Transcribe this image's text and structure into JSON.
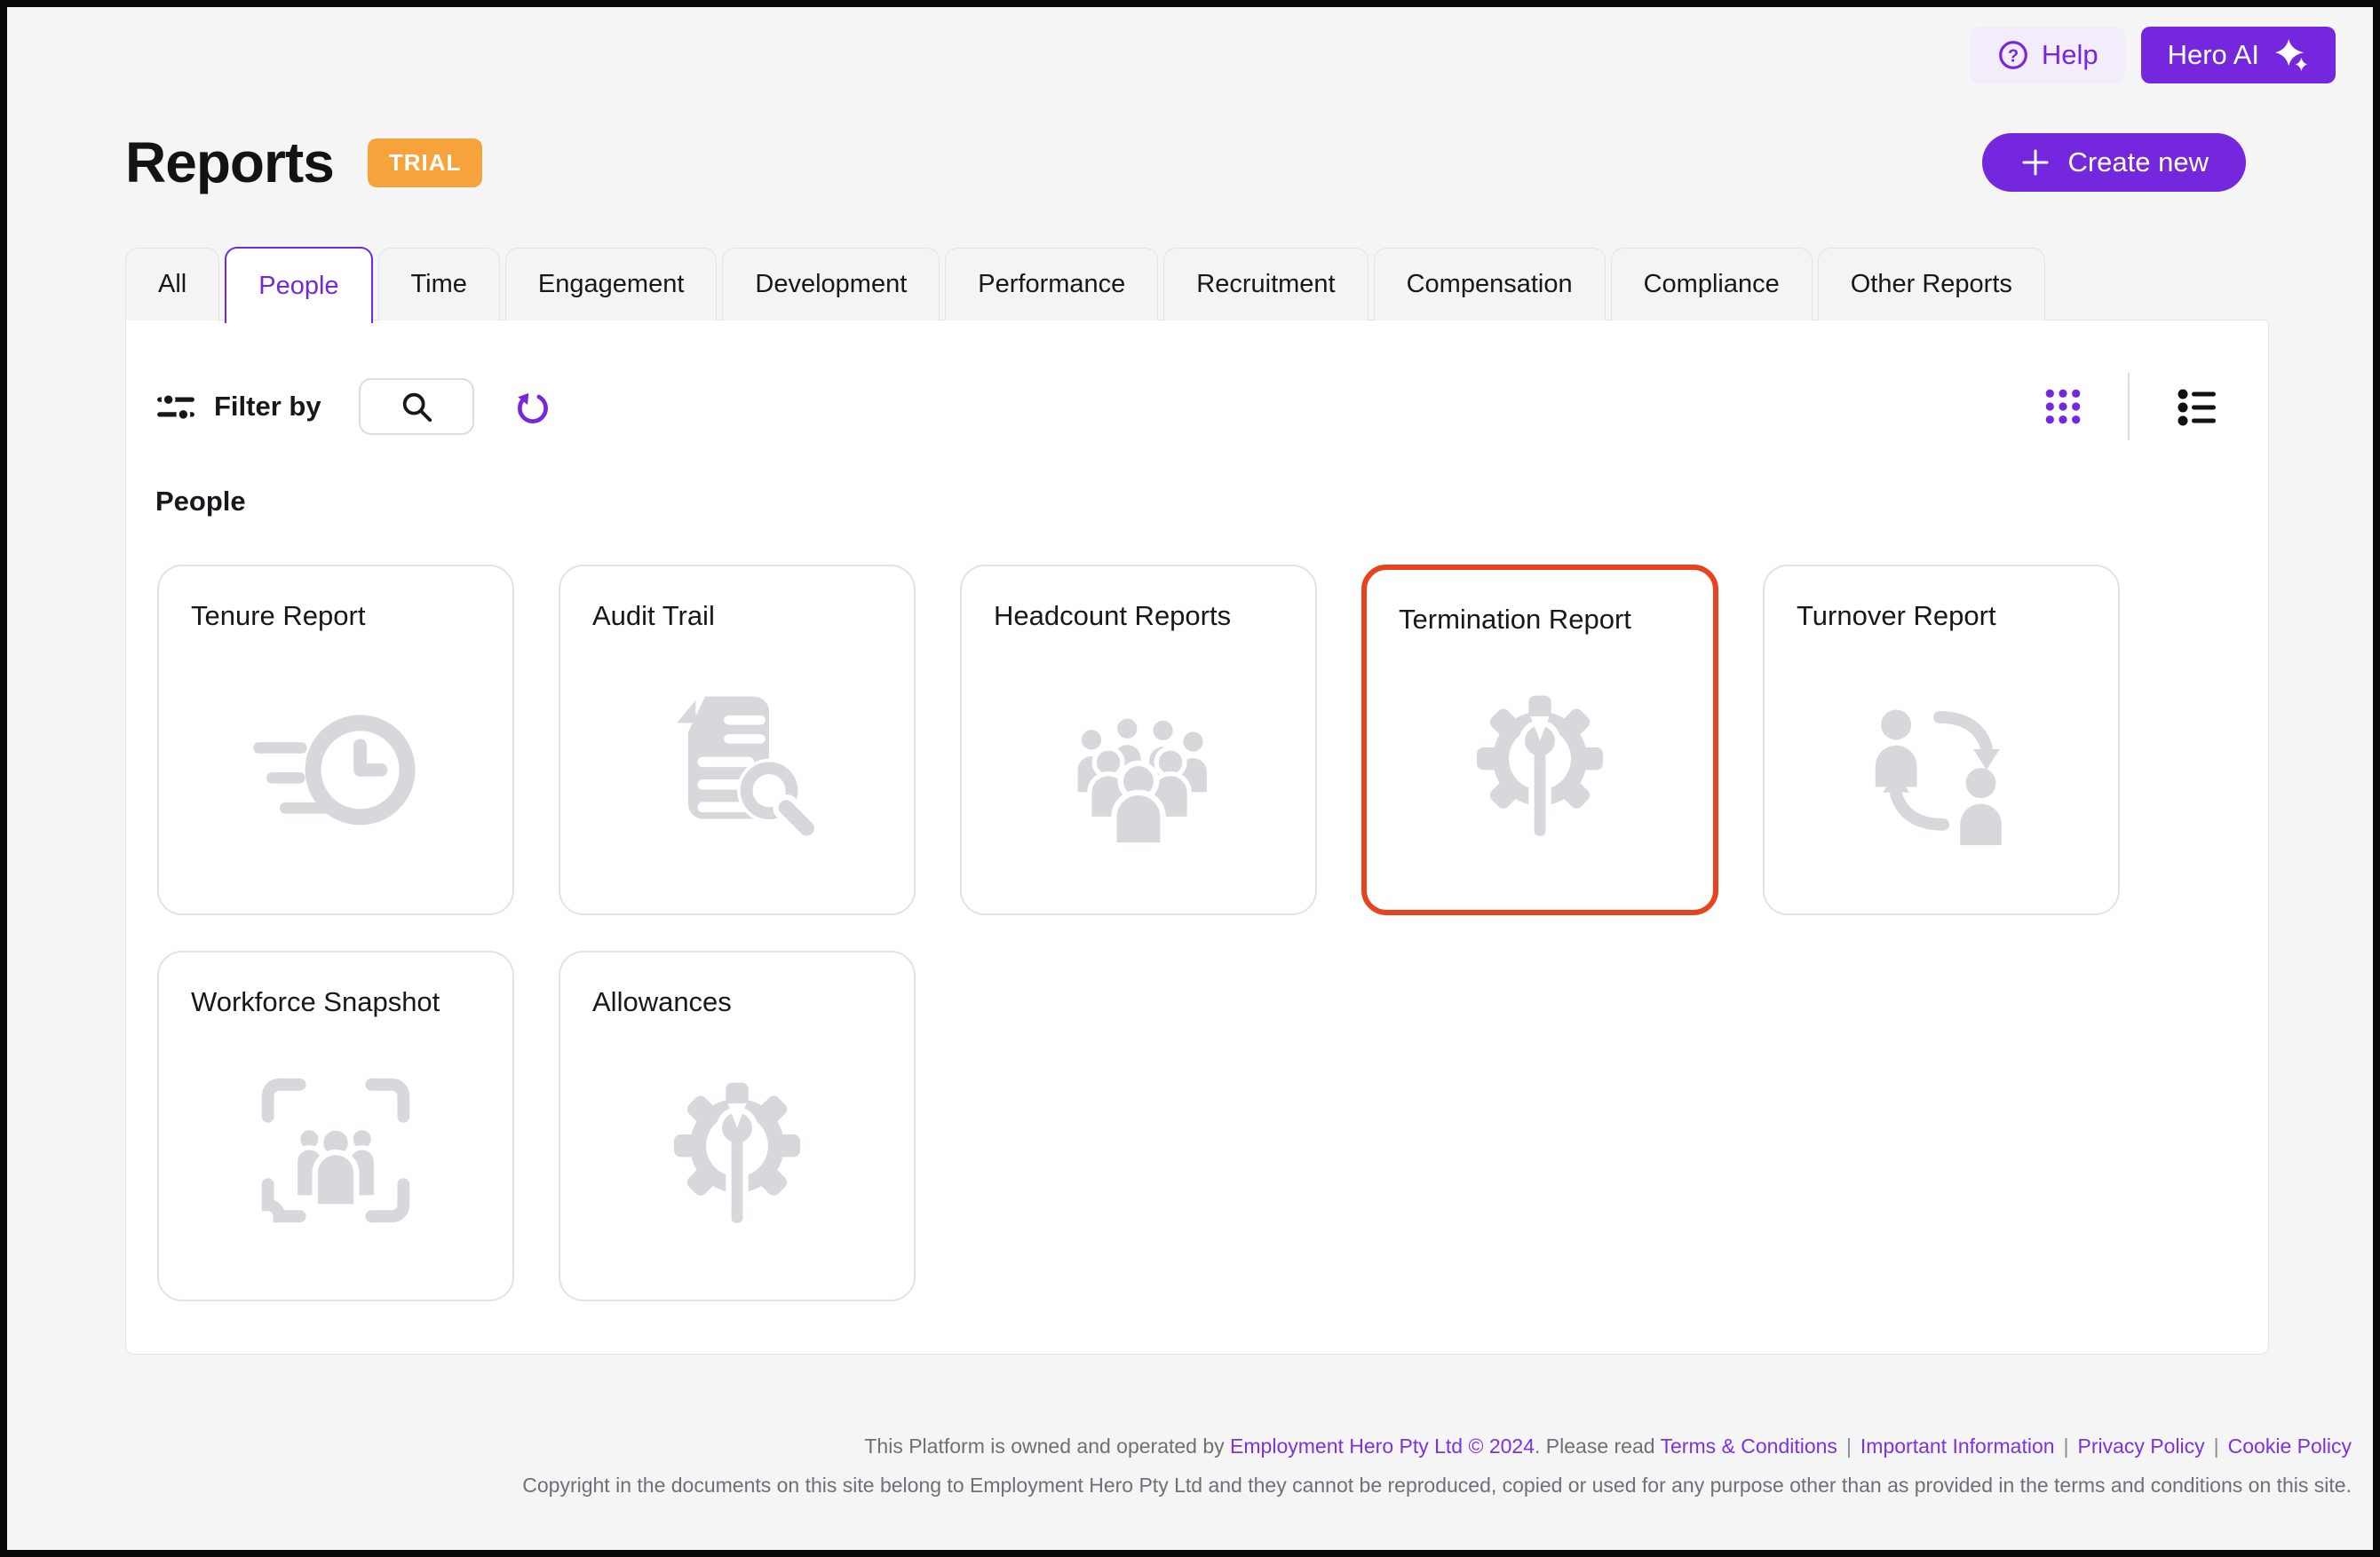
{
  "header": {
    "help_label": "Help",
    "hero_ai_label": "Hero AI",
    "title": "Reports",
    "trial_badge": "TRIAL",
    "create_new_label": "Create new"
  },
  "tabs": [
    {
      "label": "All"
    },
    {
      "label": "People",
      "active": true
    },
    {
      "label": "Time"
    },
    {
      "label": "Engagement"
    },
    {
      "label": "Development"
    },
    {
      "label": "Performance"
    },
    {
      "label": "Recruitment"
    },
    {
      "label": "Compensation"
    },
    {
      "label": "Compliance"
    },
    {
      "label": "Other Reports"
    }
  ],
  "toolbar": {
    "filter_label": "Filter by"
  },
  "section_title": "People",
  "cards": [
    {
      "title": "Tenure Report",
      "icon": "clock-fast"
    },
    {
      "title": "Audit Trail",
      "icon": "document-search"
    },
    {
      "title": "Headcount Reports",
      "icon": "people-group"
    },
    {
      "title": "Termination Report",
      "icon": "gear-wrench",
      "highlighted": true
    },
    {
      "title": "Turnover Report",
      "icon": "people-cycle"
    },
    {
      "title": "Workforce Snapshot",
      "icon": "people-frame"
    },
    {
      "title": "Allowances",
      "icon": "gear-wrench"
    }
  ],
  "footer": {
    "owned_prefix": "This Platform is owned and operated by ",
    "owner_link": "Employment Hero Pty Ltd © 2024",
    "read_prefix": ". Please read ",
    "links": [
      "Terms & Conditions",
      "Important Information",
      "Privacy Policy",
      "Cookie Policy"
    ],
    "separator": "|",
    "line2": "Copyright in the documents on this site belong to Employment Hero Pty Ltd and they cannot be reproduced, copied or used for any purpose other than as provided in the terms and conditions on this site."
  },
  "colors": {
    "accent_purple": "#7527dd",
    "trial_orange": "#f7a33c",
    "highlight_orange_red": "#e8431f",
    "card_icon_gray": "#d6d8dc"
  }
}
